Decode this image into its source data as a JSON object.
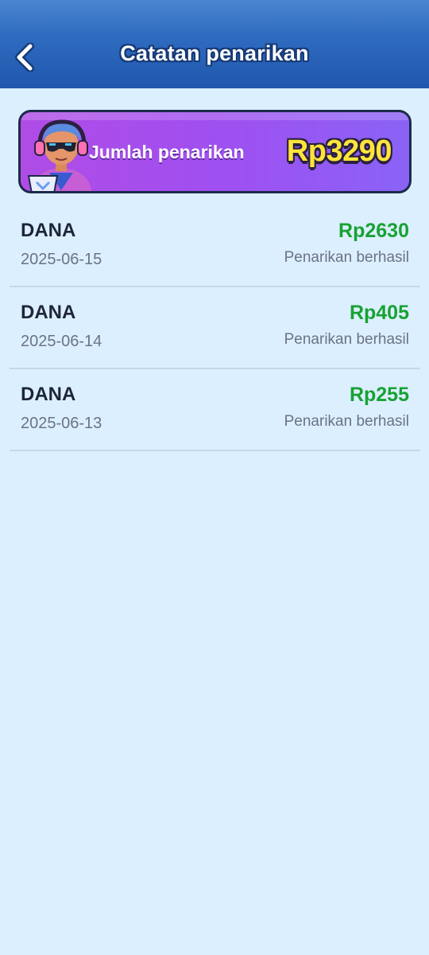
{
  "header": {
    "title": "Catatan penarikan",
    "back_icon": "chevron-left-icon"
  },
  "summary": {
    "label": "Jumlah penarikan",
    "amount": "Rp3290",
    "avatar": "dj-character-avatar"
  },
  "withdrawals": [
    {
      "method": "DANA",
      "date": "2025-06-15",
      "amount": "Rp2630",
      "status": "Penarikan berhasil"
    },
    {
      "method": "DANA",
      "date": "2025-06-14",
      "amount": "Rp405",
      "status": "Penarikan berhasil"
    },
    {
      "method": "DANA",
      "date": "2025-06-13",
      "amount": "Rp255",
      "status": "Penarikan berhasil"
    }
  ],
  "colors": {
    "header_blue": "#2f6cc0",
    "background": "#dcefff",
    "amount_green": "#17a233",
    "banner_purple": "#a04ff0",
    "banner_amount_yellow": "#ffe53a"
  }
}
